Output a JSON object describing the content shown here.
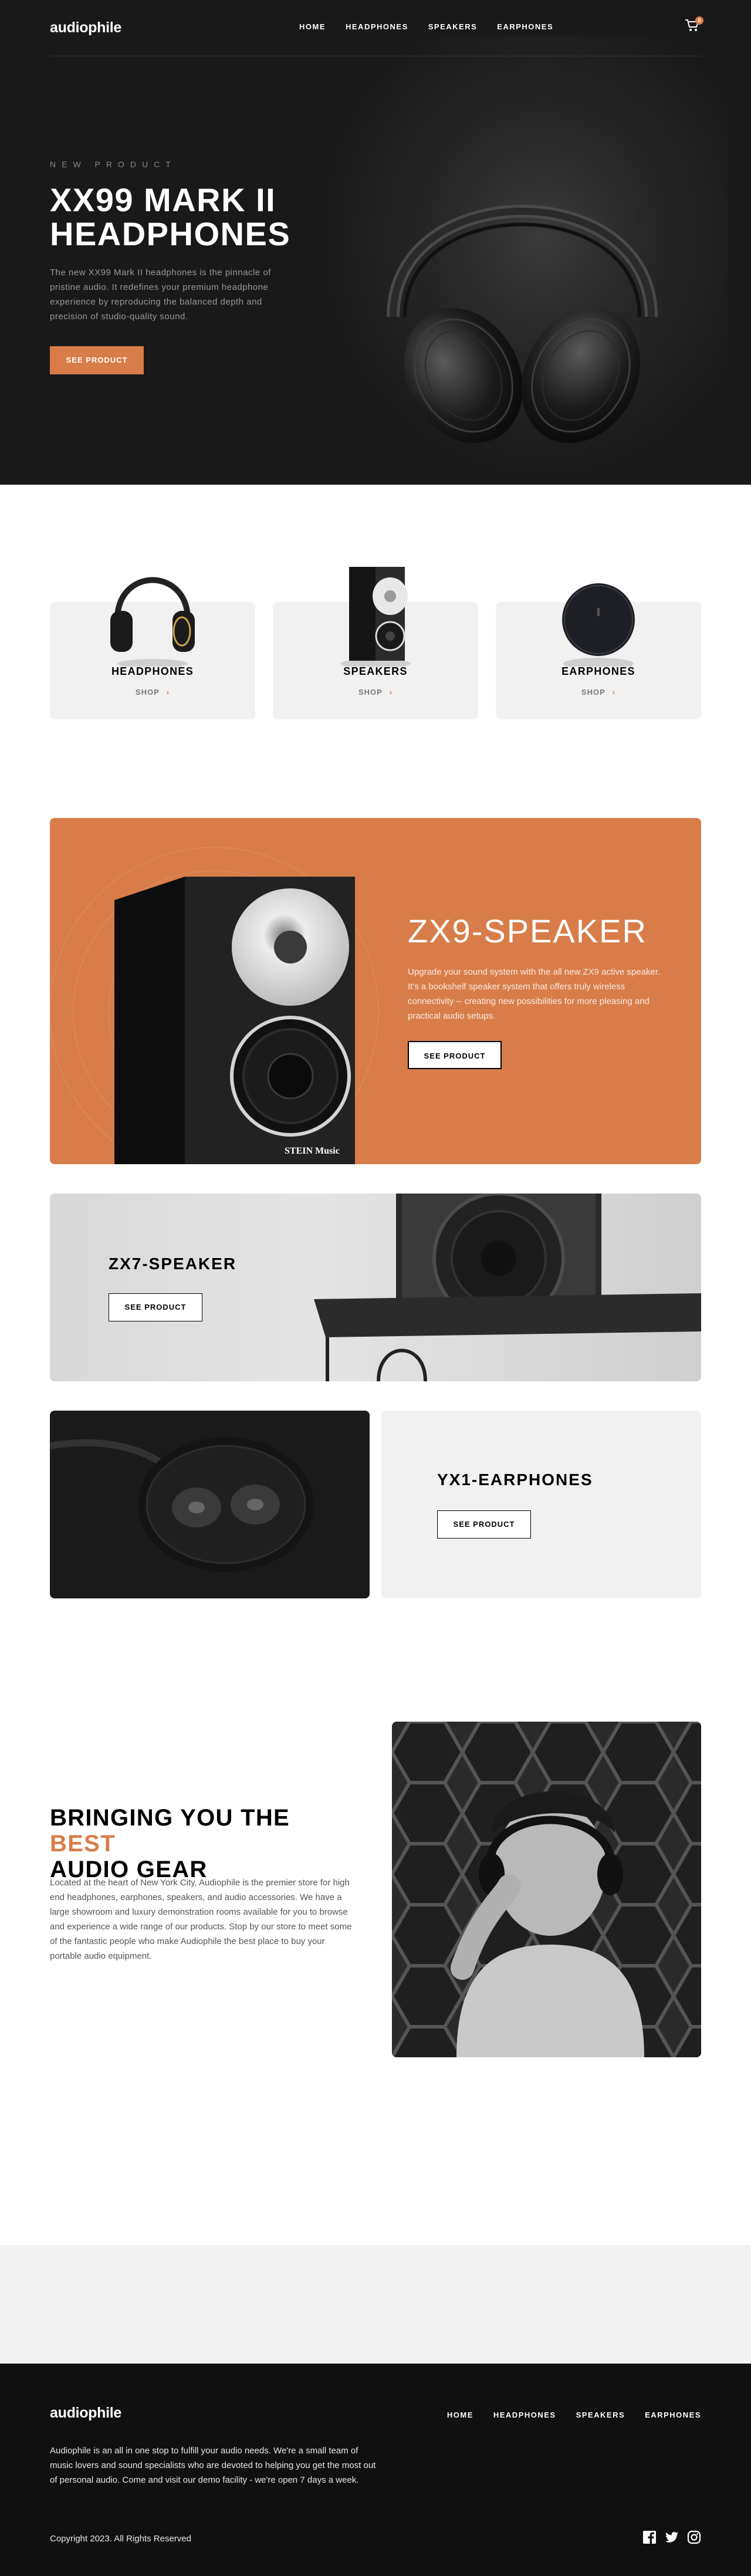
{
  "brand": {
    "logo": "audiophile"
  },
  "nav": {
    "items": [
      "HOME",
      "HEADPHONES",
      "SPEAKERS",
      "EARPHONES"
    ],
    "cart_count": "0"
  },
  "hero": {
    "overline": "NEW PRODUCT",
    "title_line1": "XX99 MARK II",
    "title_line2": "HEADPHONES",
    "description": "The new XX99 Mark II headphones is the pinnacle of pristine audio. It redefines your premium headphone experience by reproducing the balanced depth and precision of studio-quality sound.",
    "button": "SEE PRODUCT"
  },
  "categories": [
    {
      "name": "HEADPHONES",
      "shop": "SHOP",
      "icon": "headphones-image"
    },
    {
      "name": "SPEAKERS",
      "shop": "SHOP",
      "icon": "speaker-image"
    },
    {
      "name": "EARPHONES",
      "shop": "SHOP",
      "icon": "earphones-image"
    }
  ],
  "zx9": {
    "title": "ZX9-SPEAKER",
    "description": "Upgrade your sound system with the all new ZX9 active speaker. It's a bookshelf speaker system that offers truly wireless connectivity -- creating new possibilities for more pleasing and practical audio setups.",
    "button": "SEE PRODUCT",
    "brand_mark": "STEIN Music"
  },
  "zx7": {
    "title": "ZX7-SPEAKER",
    "button": "SEE PRODUCT"
  },
  "yx1": {
    "title": "YX1-EARPHONES",
    "button": "SEE PRODUCT"
  },
  "about": {
    "title_pre": "BRINGING YOU THE ",
    "title_accent": "BEST",
    "title_post": "AUDIO GEAR",
    "description": "Located at the heart of New York City, Audiophile is the premier store for high end headphones, earphones, speakers, and audio accessories. We have a large showroom and luxury demonstration rooms available for you to browse and experience a wide range of our products. Stop by our store to meet some of the fantastic people who make Audiophile the best place to buy your portable audio equipment."
  },
  "footer": {
    "logo": "audiophile",
    "links": [
      "HOME",
      "HEADPHONES",
      "SPEAKERS",
      "EARPHONES"
    ],
    "description": "Audiophile is an all in one stop to fulfill your audio needs. We're a small team of music lovers and sound specialists who are devoted to helping you get the most out of personal audio. Come and visit our demo facility - we're open 7 days a week.",
    "copyright": "Copyright 2023. All Rights Reserved",
    "socials": [
      "facebook-icon",
      "twitter-icon",
      "instagram-icon"
    ]
  },
  "colors": {
    "accent": "#d87d4a",
    "dark": "#191919",
    "light": "#f1f1f1"
  }
}
